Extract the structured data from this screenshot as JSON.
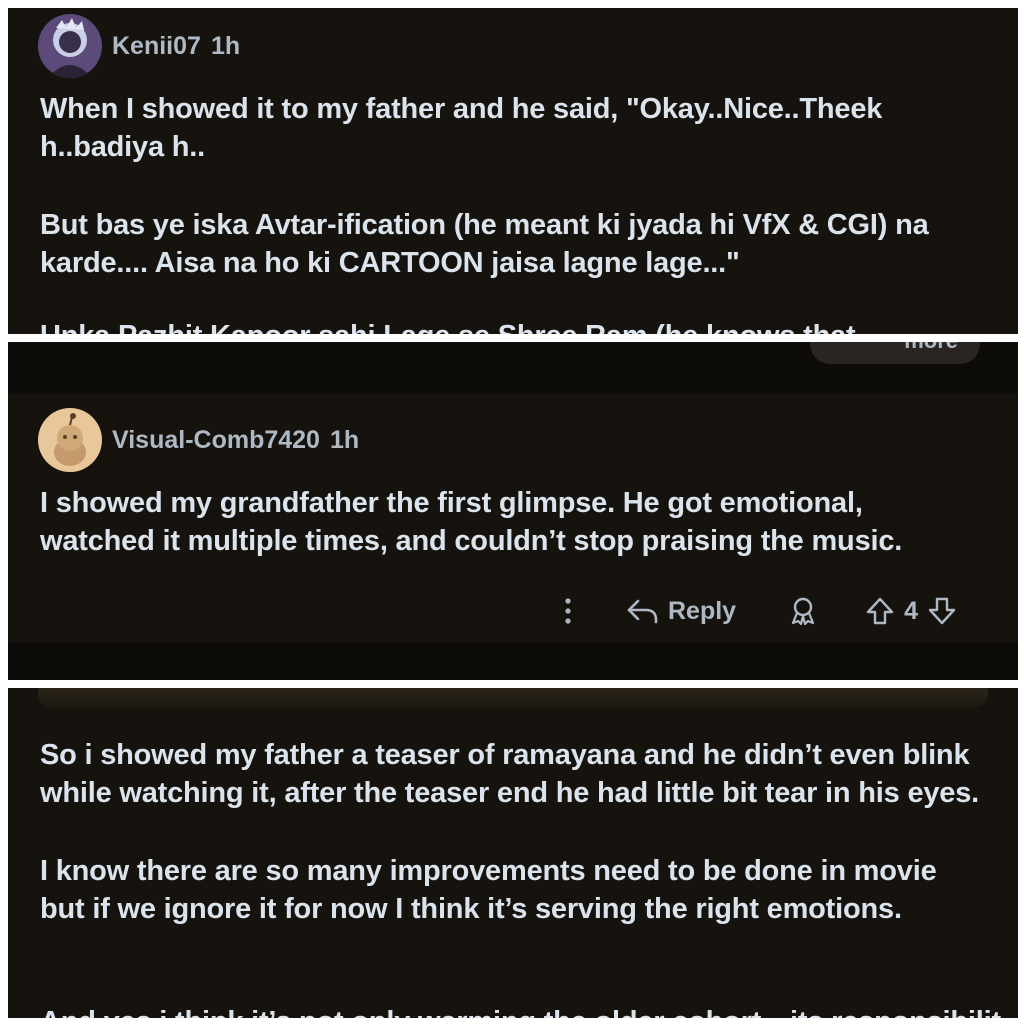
{
  "comments": [
    {
      "username": "Kenii07",
      "time": "1h",
      "paragraphs": [
        "When I showed it to my father and he said, \"Okay..Nice..Theek h..badiya h..",
        "But bas ye iska Avtar-ification (he meant ki jyada hi VfX & CGI) na karde.... Aisa na ho ki CARTOON jaisa lagne lage...\""
      ],
      "cutoff_text": "Unka Pazhit Kapoor sahi Lage se Shree Ram (he knows that",
      "more_label": "more"
    },
    {
      "username": "Visual-Comb7420",
      "time": "1h",
      "paragraphs": [
        "I showed my grandfather the first glimpse. He got emotional, watched it multiple times, and couldn’t stop praising the music."
      ],
      "actions": {
        "more_icon": "more-vertical-icon",
        "reply_label": "Reply",
        "award_icon": "award-icon",
        "vote_count": "4"
      }
    },
    {
      "paragraphs": [
        "So i showed my father a teaser of ramayana and he didn’t even blink while watching it, after the teaser end he had little bit tear in his eyes.",
        "I know there are so many improvements need to be done in movie but if we ignore it for now I think it’s serving the right emotions."
      ],
      "cutoff_text": "And yes i think it’s not only warming the older cohort—its responsibilit"
    }
  ],
  "colors": {
    "background": "#16130e",
    "text": "#dbe3ec",
    "meta": "#aeb9c4",
    "divider": "#ffffff"
  }
}
